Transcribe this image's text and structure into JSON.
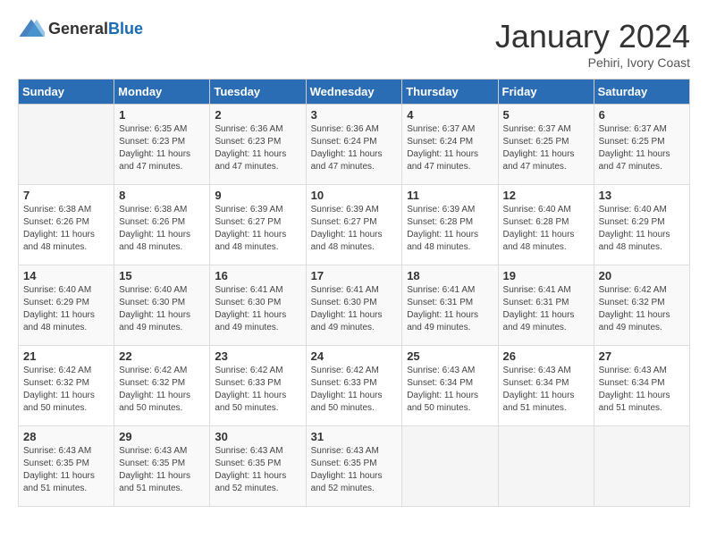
{
  "header": {
    "logo_general": "General",
    "logo_blue": "Blue",
    "title": "January 2024",
    "location": "Pehiri, Ivory Coast"
  },
  "days_of_week": [
    "Sunday",
    "Monday",
    "Tuesday",
    "Wednesday",
    "Thursday",
    "Friday",
    "Saturday"
  ],
  "weeks": [
    [
      {
        "day": "",
        "info": ""
      },
      {
        "day": "1",
        "info": "Sunrise: 6:35 AM\nSunset: 6:23 PM\nDaylight: 11 hours and 47 minutes."
      },
      {
        "day": "2",
        "info": "Sunrise: 6:36 AM\nSunset: 6:23 PM\nDaylight: 11 hours and 47 minutes."
      },
      {
        "day": "3",
        "info": "Sunrise: 6:36 AM\nSunset: 6:24 PM\nDaylight: 11 hours and 47 minutes."
      },
      {
        "day": "4",
        "info": "Sunrise: 6:37 AM\nSunset: 6:24 PM\nDaylight: 11 hours and 47 minutes."
      },
      {
        "day": "5",
        "info": "Sunrise: 6:37 AM\nSunset: 6:25 PM\nDaylight: 11 hours and 47 minutes."
      },
      {
        "day": "6",
        "info": "Sunrise: 6:37 AM\nSunset: 6:25 PM\nDaylight: 11 hours and 47 minutes."
      }
    ],
    [
      {
        "day": "7",
        "info": "Sunrise: 6:38 AM\nSunset: 6:26 PM\nDaylight: 11 hours and 48 minutes."
      },
      {
        "day": "8",
        "info": "Sunrise: 6:38 AM\nSunset: 6:26 PM\nDaylight: 11 hours and 48 minutes."
      },
      {
        "day": "9",
        "info": "Sunrise: 6:39 AM\nSunset: 6:27 PM\nDaylight: 11 hours and 48 minutes."
      },
      {
        "day": "10",
        "info": "Sunrise: 6:39 AM\nSunset: 6:27 PM\nDaylight: 11 hours and 48 minutes."
      },
      {
        "day": "11",
        "info": "Sunrise: 6:39 AM\nSunset: 6:28 PM\nDaylight: 11 hours and 48 minutes."
      },
      {
        "day": "12",
        "info": "Sunrise: 6:40 AM\nSunset: 6:28 PM\nDaylight: 11 hours and 48 minutes."
      },
      {
        "day": "13",
        "info": "Sunrise: 6:40 AM\nSunset: 6:29 PM\nDaylight: 11 hours and 48 minutes."
      }
    ],
    [
      {
        "day": "14",
        "info": "Sunrise: 6:40 AM\nSunset: 6:29 PM\nDaylight: 11 hours and 48 minutes."
      },
      {
        "day": "15",
        "info": "Sunrise: 6:40 AM\nSunset: 6:30 PM\nDaylight: 11 hours and 49 minutes."
      },
      {
        "day": "16",
        "info": "Sunrise: 6:41 AM\nSunset: 6:30 PM\nDaylight: 11 hours and 49 minutes."
      },
      {
        "day": "17",
        "info": "Sunrise: 6:41 AM\nSunset: 6:30 PM\nDaylight: 11 hours and 49 minutes."
      },
      {
        "day": "18",
        "info": "Sunrise: 6:41 AM\nSunset: 6:31 PM\nDaylight: 11 hours and 49 minutes."
      },
      {
        "day": "19",
        "info": "Sunrise: 6:41 AM\nSunset: 6:31 PM\nDaylight: 11 hours and 49 minutes."
      },
      {
        "day": "20",
        "info": "Sunrise: 6:42 AM\nSunset: 6:32 PM\nDaylight: 11 hours and 49 minutes."
      }
    ],
    [
      {
        "day": "21",
        "info": "Sunrise: 6:42 AM\nSunset: 6:32 PM\nDaylight: 11 hours and 50 minutes."
      },
      {
        "day": "22",
        "info": "Sunrise: 6:42 AM\nSunset: 6:32 PM\nDaylight: 11 hours and 50 minutes."
      },
      {
        "day": "23",
        "info": "Sunrise: 6:42 AM\nSunset: 6:33 PM\nDaylight: 11 hours and 50 minutes."
      },
      {
        "day": "24",
        "info": "Sunrise: 6:42 AM\nSunset: 6:33 PM\nDaylight: 11 hours and 50 minutes."
      },
      {
        "day": "25",
        "info": "Sunrise: 6:43 AM\nSunset: 6:34 PM\nDaylight: 11 hours and 50 minutes."
      },
      {
        "day": "26",
        "info": "Sunrise: 6:43 AM\nSunset: 6:34 PM\nDaylight: 11 hours and 51 minutes."
      },
      {
        "day": "27",
        "info": "Sunrise: 6:43 AM\nSunset: 6:34 PM\nDaylight: 11 hours and 51 minutes."
      }
    ],
    [
      {
        "day": "28",
        "info": "Sunrise: 6:43 AM\nSunset: 6:35 PM\nDaylight: 11 hours and 51 minutes."
      },
      {
        "day": "29",
        "info": "Sunrise: 6:43 AM\nSunset: 6:35 PM\nDaylight: 11 hours and 51 minutes."
      },
      {
        "day": "30",
        "info": "Sunrise: 6:43 AM\nSunset: 6:35 PM\nDaylight: 11 hours and 52 minutes."
      },
      {
        "day": "31",
        "info": "Sunrise: 6:43 AM\nSunset: 6:35 PM\nDaylight: 11 hours and 52 minutes."
      },
      {
        "day": "",
        "info": ""
      },
      {
        "day": "",
        "info": ""
      },
      {
        "day": "",
        "info": ""
      }
    ]
  ]
}
